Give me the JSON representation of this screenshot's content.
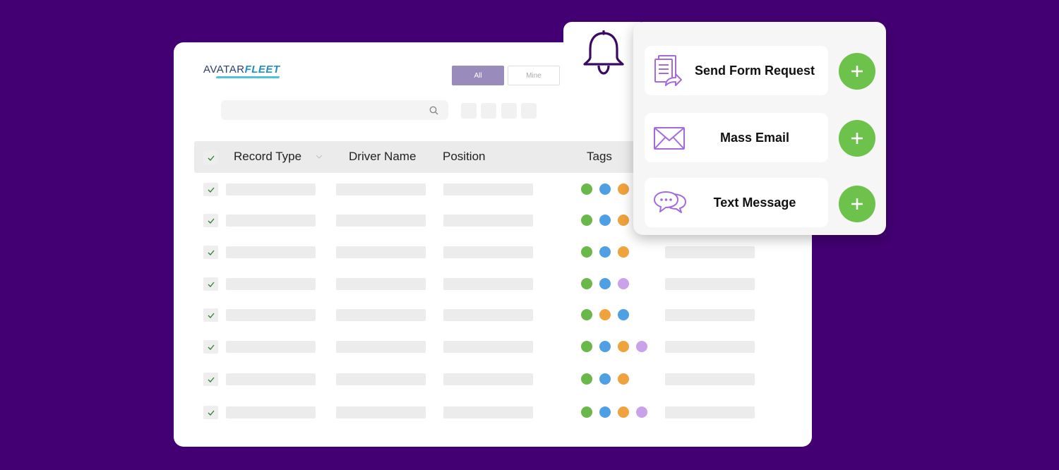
{
  "app": {
    "logo_part1": "AVATAR",
    "logo_part2": "FLEET"
  },
  "filters": {
    "all_label": "All",
    "mine_label": "Mine"
  },
  "table": {
    "columns": [
      "Record Type",
      "Driver Name",
      "Position",
      "Tags"
    ],
    "rows": [
      {
        "checked": true,
        "tags": [
          "green",
          "blue",
          "orange"
        ]
      },
      {
        "checked": true,
        "tags": [
          "green",
          "blue",
          "orange"
        ]
      },
      {
        "checked": true,
        "tags": [
          "green",
          "blue",
          "orange"
        ]
      },
      {
        "checked": true,
        "tags": [
          "green",
          "blue",
          "lavender"
        ]
      },
      {
        "checked": true,
        "tags": [
          "green",
          "orange",
          "blue"
        ]
      },
      {
        "checked": true,
        "tags": [
          "green",
          "blue",
          "orange",
          "lavender"
        ]
      },
      {
        "checked": true,
        "tags": [
          "green",
          "blue",
          "orange"
        ]
      },
      {
        "checked": true,
        "tags": [
          "green",
          "blue",
          "orange",
          "lavender"
        ]
      }
    ]
  },
  "actions": [
    {
      "label": "Send Form Request",
      "icon": "form-document-icon"
    },
    {
      "label": "Mass Email",
      "icon": "envelope-icon"
    },
    {
      "label": "Text Message",
      "icon": "chat-bubbles-icon"
    }
  ],
  "colors": {
    "background": "#430073",
    "accent_green": "#6cc24a",
    "icon_purple": "#a46be0",
    "tag_green": "#6ab84a",
    "tag_blue": "#4e9fe3",
    "tag_orange": "#f0a23c",
    "tag_lavender": "#c9a2ea"
  }
}
